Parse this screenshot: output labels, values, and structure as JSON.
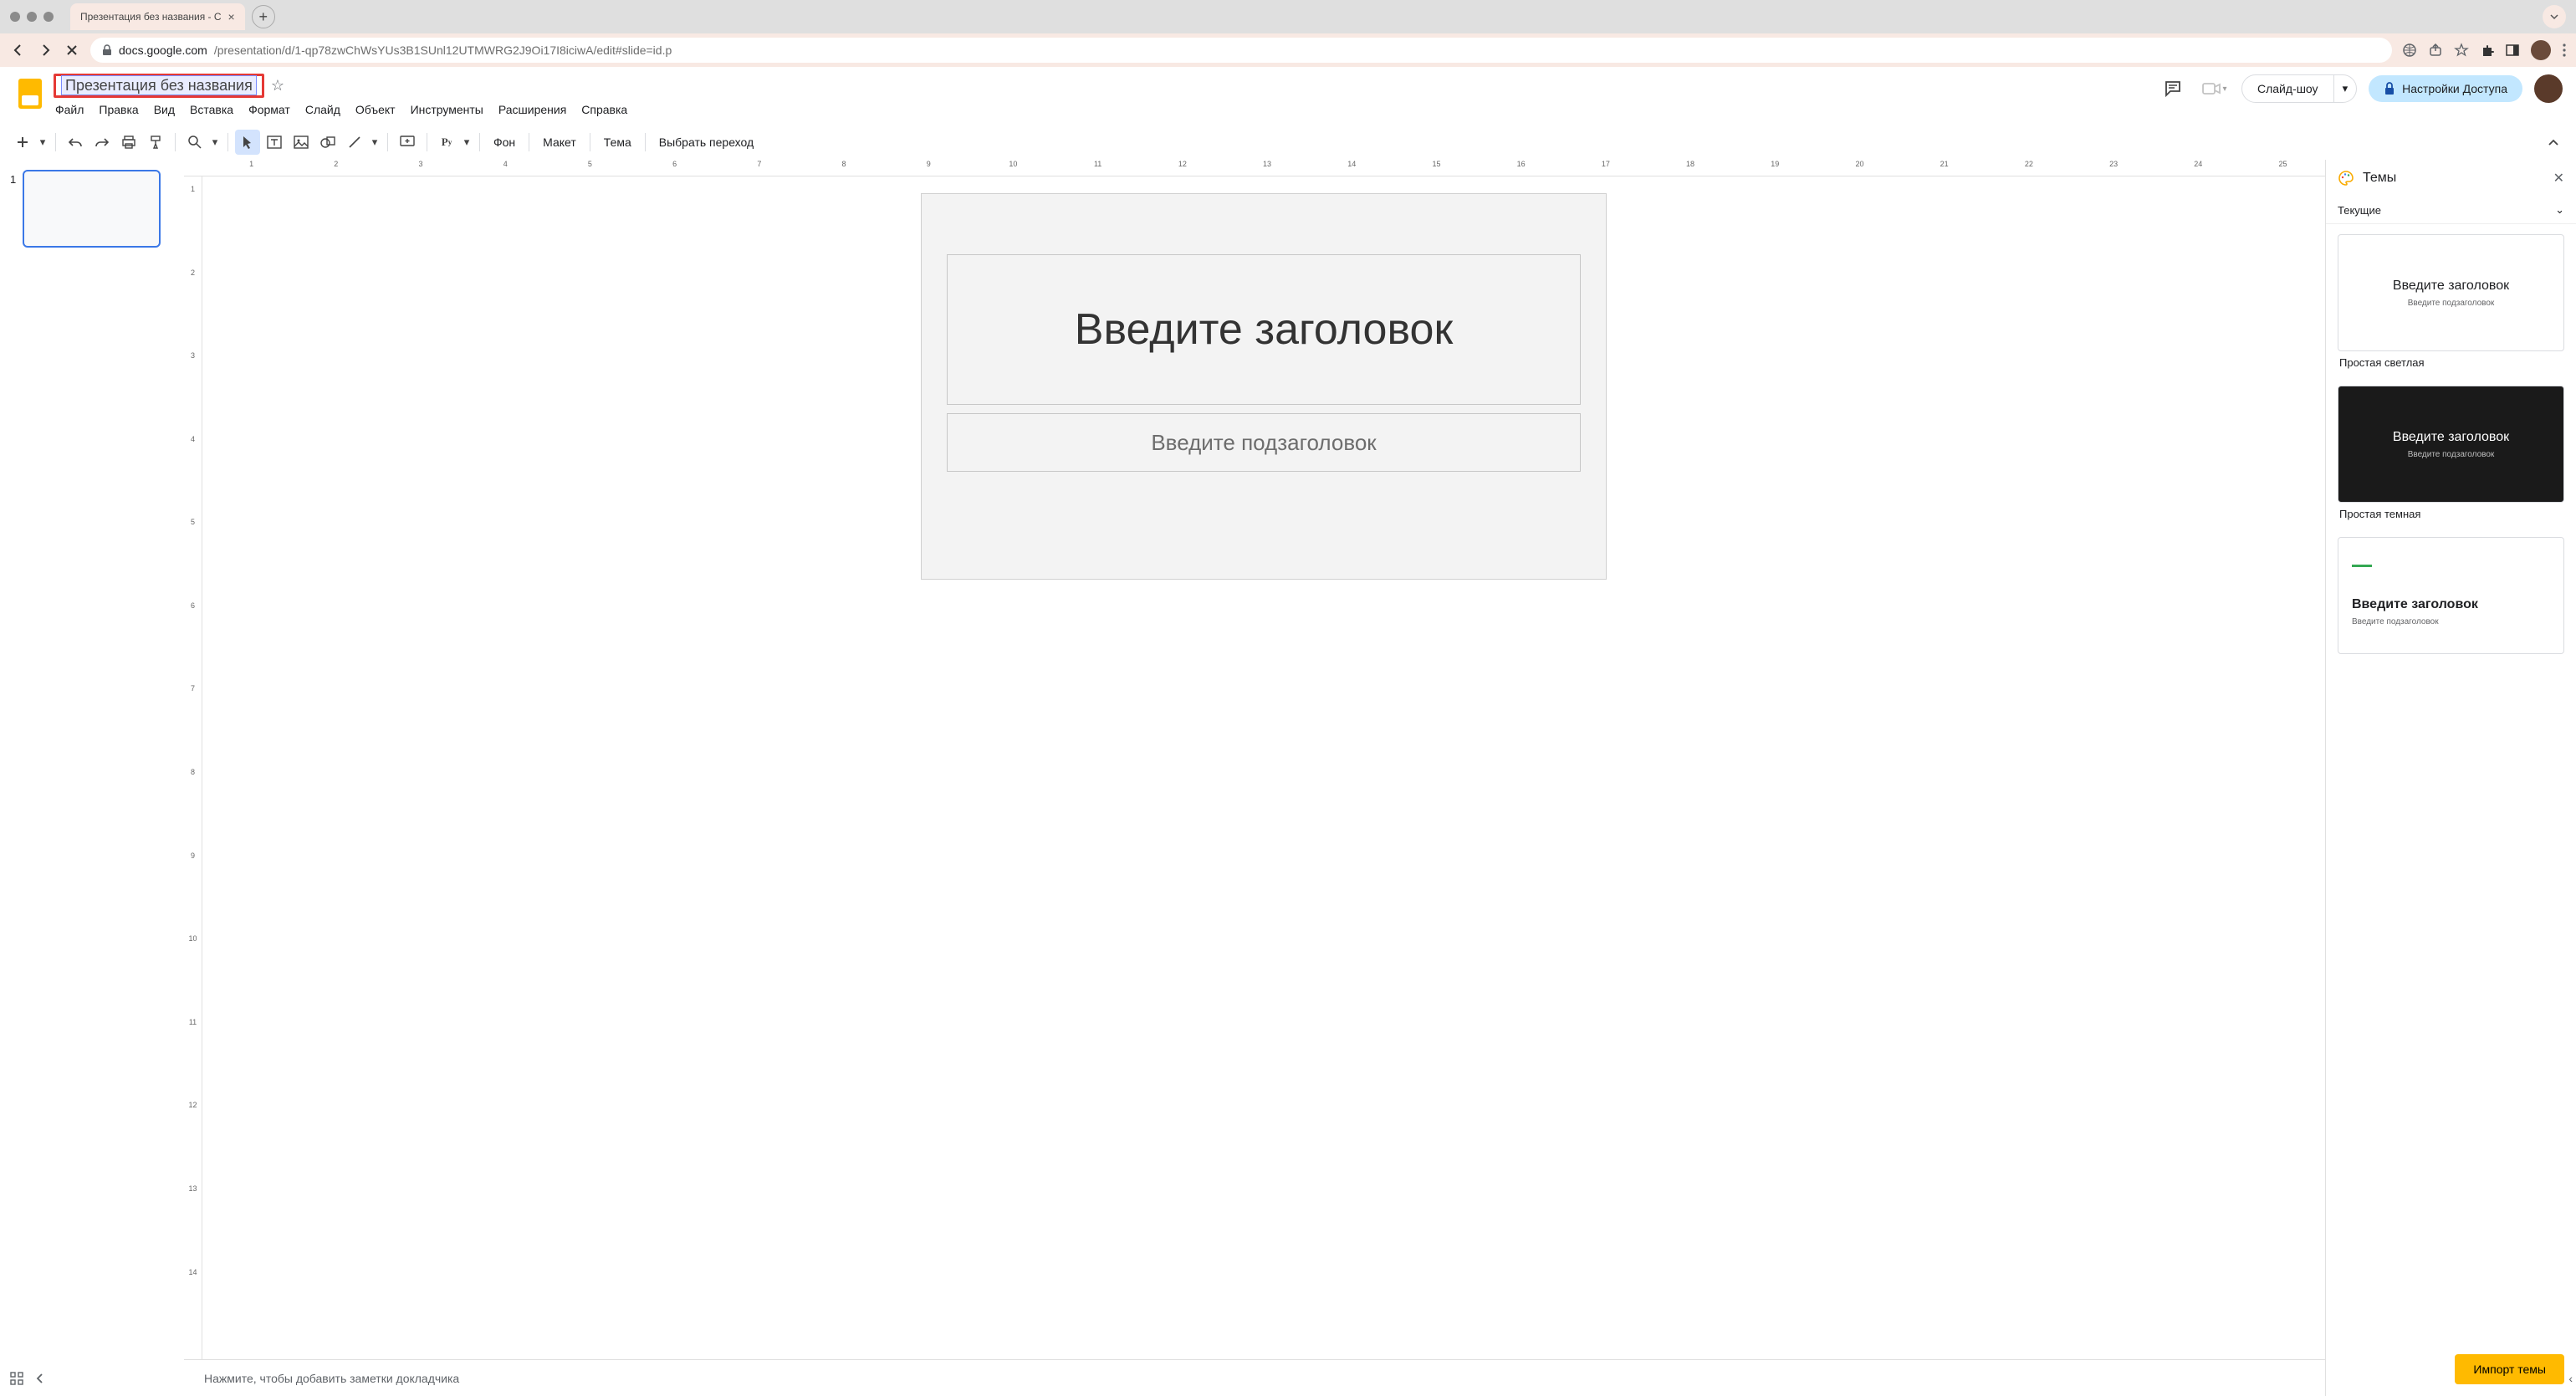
{
  "browser": {
    "tab_title": "Презентация без названия - С",
    "url_host": "docs.google.com",
    "url_path": "/presentation/d/1-qp78zwChWsYUs3B1SUnl12UTMWRG2J9Oi17I8iciwA/edit#slide=id.p"
  },
  "header": {
    "doc_title": "Презентация без названия",
    "menus": [
      "Файл",
      "Правка",
      "Вид",
      "Вставка",
      "Формат",
      "Слайд",
      "Объект",
      "Инструменты",
      "Расширения",
      "Справка"
    ],
    "slideshow_label": "Слайд-шоу",
    "share_label": "Настройки Доступа"
  },
  "toolbar": {
    "bg_label": "Фон",
    "layout_label": "Макет",
    "theme_label": "Тема",
    "transition_label": "Выбрать переход",
    "textbox_prefix": "Р",
    "textbox_suffix": "у"
  },
  "slide": {
    "number": "1",
    "title_placeholder": "Введите заголовок",
    "subtitle_placeholder": "Введите подзаголовок"
  },
  "notes": {
    "placeholder": "Нажмите, чтобы добавить заметки докладчика"
  },
  "themes_panel": {
    "title": "Темы",
    "current_label": "Текущие",
    "import_label": "Импорт темы",
    "themes": [
      {
        "preview_title": "Введите заголовок",
        "preview_sub": "Введите подзаголовок",
        "label": "Простая светлая",
        "style": "light"
      },
      {
        "preview_title": "Введите заголовок",
        "preview_sub": "Введите подзаголовок",
        "label": "Простая темная",
        "style": "dark"
      },
      {
        "preview_title": "Введите заголовок",
        "preview_sub": "Введите подзаголовок",
        "label": "",
        "style": "accent"
      }
    ]
  },
  "ruler_h": [
    "1",
    "2",
    "3",
    "4",
    "5",
    "6",
    "7",
    "8",
    "9",
    "10",
    "11",
    "12",
    "13",
    "14",
    "15",
    "16",
    "17",
    "18",
    "19",
    "20",
    "21",
    "22",
    "23",
    "24",
    "25"
  ],
  "ruler_v": [
    "1",
    "2",
    "3",
    "4",
    "5",
    "6",
    "7",
    "8",
    "9",
    "10",
    "11",
    "12",
    "13",
    "14"
  ]
}
